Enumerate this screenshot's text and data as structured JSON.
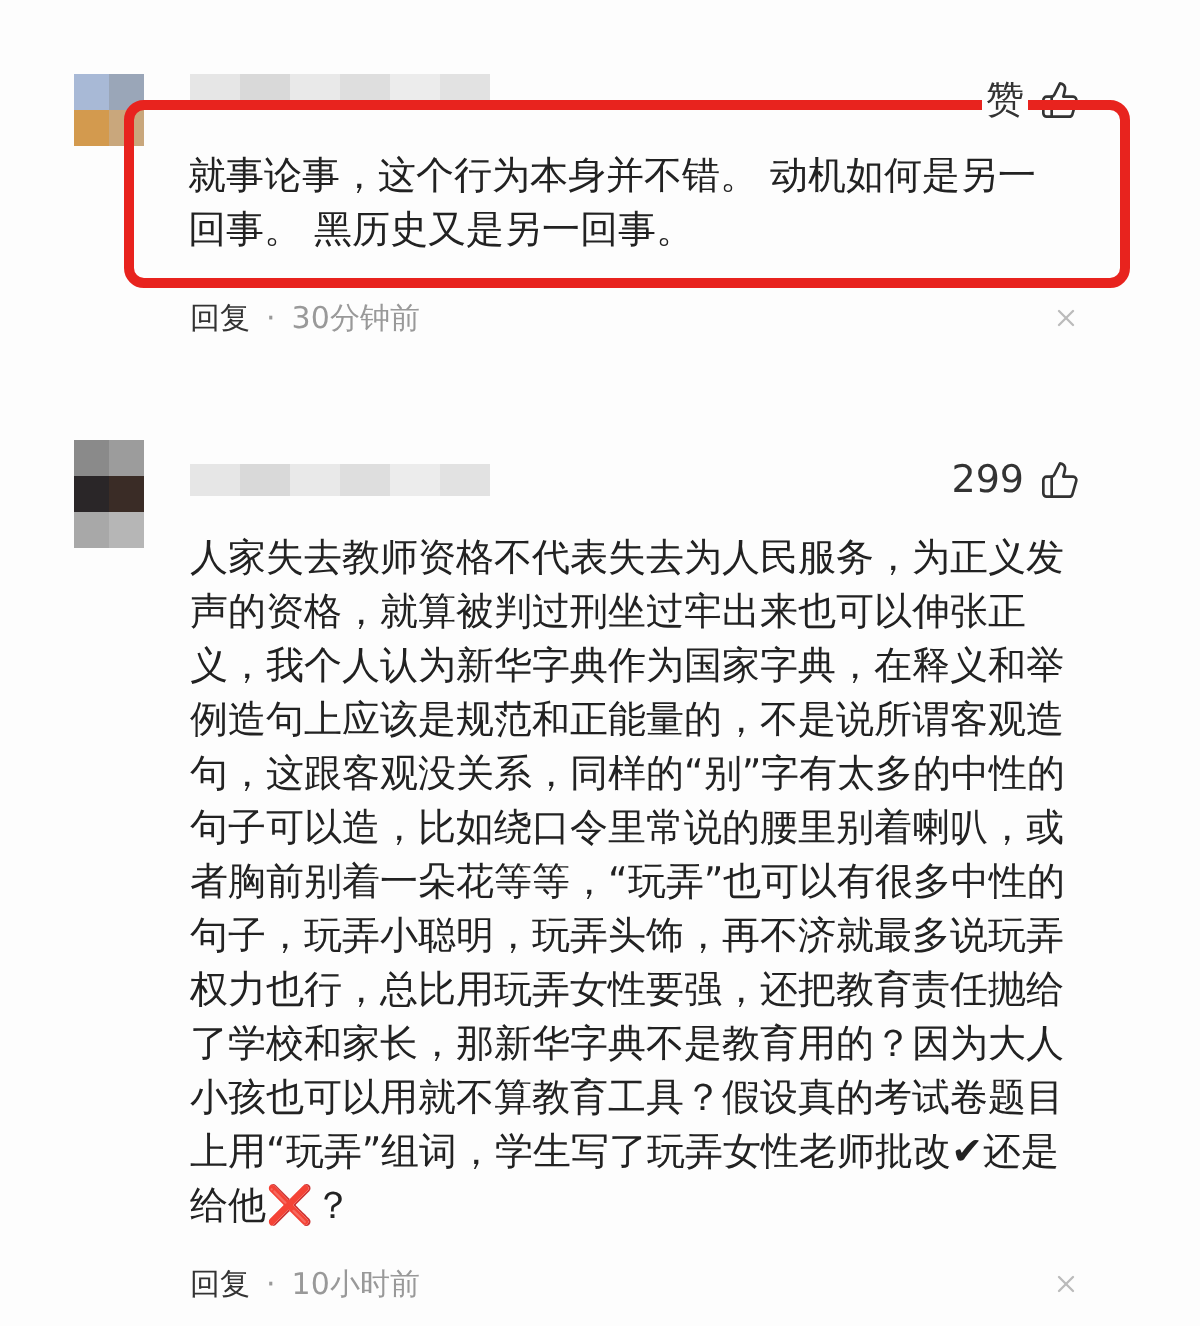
{
  "comments": [
    {
      "highlighted": true,
      "likes": "赞",
      "text": "就事论事，这个行为本身并不错。 动机如何是另一回事。 黑历史又是另一回事。",
      "reply": "回复",
      "separator": "·",
      "time": "30分钟前"
    },
    {
      "highlighted": false,
      "likes": "299",
      "text": "人家失去教师资格不代表失去为人民服务，为正义发声的资格，就算被判过刑坐过牢出来也可以伸张正义，我个人认为新华字典作为国家字典，在释义和举例造句上应该是规范和正能量的，不是说所谓客观造句，这跟客观没关系，同样的“别”字有太多的中性的句子可以造，比如绕口令里常说的腰里别着喇叭，或者胸前别着一朵花等等，“玩弄”也可以有很多中性的句子，玩弄小聪明，玩弄头饰，再不济就最多说玩弄权力也行，总比用玩弄女性要强，还把教育责任抛给了学校和家长，那新华字典不是教育用的？因为大人小孩也可以用就不算教育工具？假设真的考试卷题目上用“玩弄”组词，学生写了玩弄女性老师批改✔还是给他❌？",
      "reply": "回复",
      "separator": "·",
      "time": "10小时前"
    }
  ]
}
